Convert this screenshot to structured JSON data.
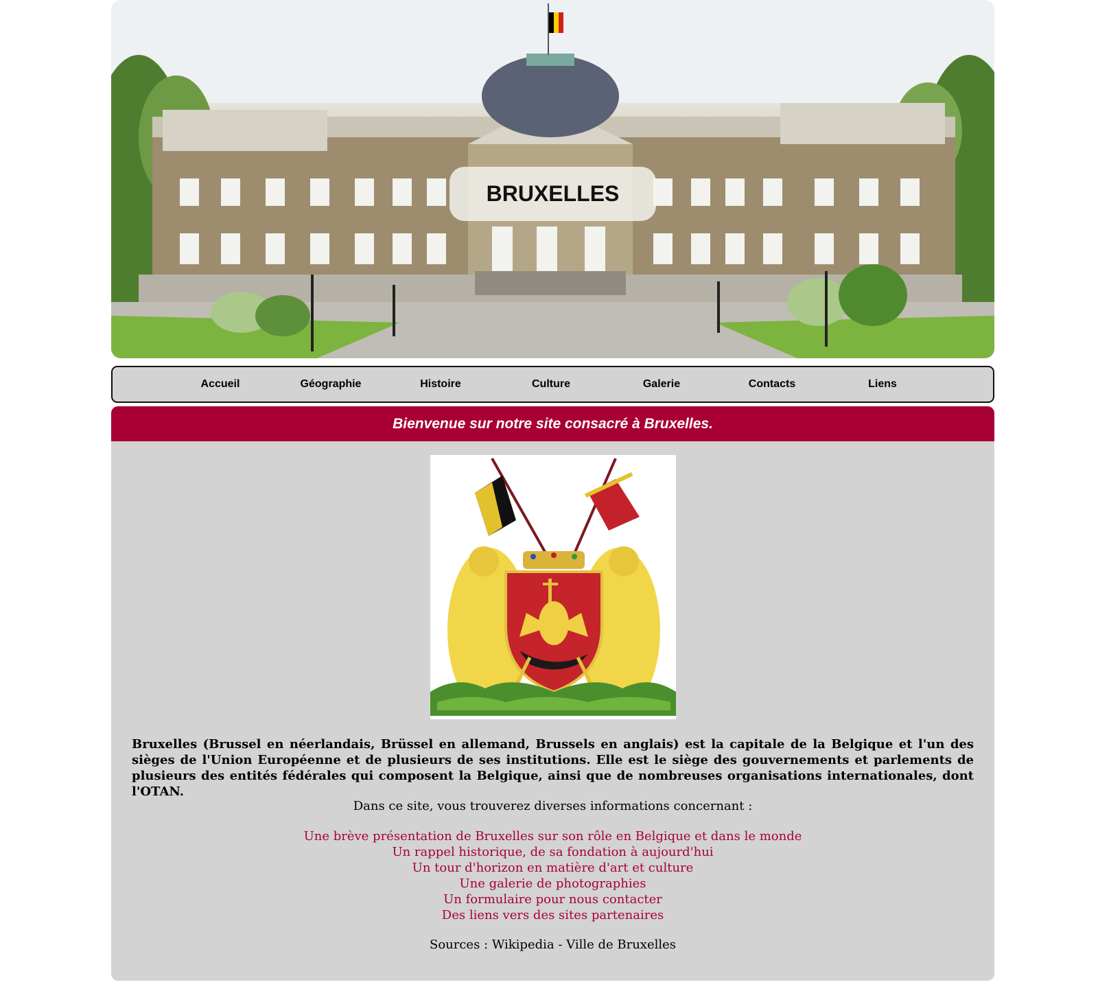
{
  "header": {
    "title": "BRUXELLES",
    "image_alt": "Palais de Laeken"
  },
  "nav": {
    "items": [
      {
        "label": "Accueil"
      },
      {
        "label": "Géographie"
      },
      {
        "label": "Histoire"
      },
      {
        "label": "Culture"
      },
      {
        "label": "Galerie"
      },
      {
        "label": "Contacts"
      },
      {
        "label": "Liens"
      }
    ]
  },
  "welcome": "Bienvenue sur notre site consacré à Bruxelles.",
  "content": {
    "intro": "Bruxelles (Brussel en néerlandais, Brüssel en allemand, Brussels en anglais) est la capitale de la Belgique et l'un des sièges de l'Union Européenne et de plusieurs de ses institutions. Elle est le siège des gouvernements et parlements de plusieurs des entités fédérales qui composent la Belgique, ainsi que de nombreuses organisations internationales, dont l'OTAN.",
    "lead": "Dans ce site, vous trouverez diverses informations concernant :",
    "links": [
      "Une brève présentation de Bruxelles sur son rôle en Belgique et dans le monde",
      "Un rappel historique, de sa fondation à aujourd'hui",
      "Un tour d'horizon en matière d'art et culture",
      "Une galerie de photographies",
      "Un formulaire pour nous contacter",
      "Des liens vers des sites partenaires"
    ],
    "sources": "Sources : Wikipedia - Ville de Bruxelles"
  },
  "colors": {
    "accent": "#a80035",
    "panel": "#d3d3d3"
  }
}
